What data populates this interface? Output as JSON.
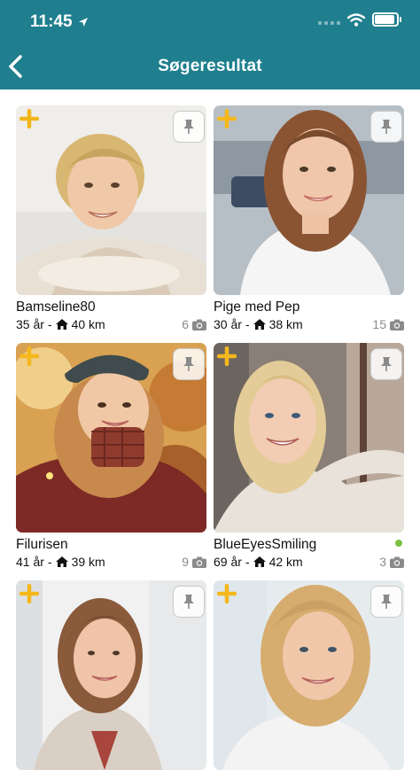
{
  "status": {
    "time": "11:45"
  },
  "header": {
    "title": "Søgeresultat",
    "back_icon": "chevron-left-icon"
  },
  "colors": {
    "header_bg": "#1f7f8e",
    "plus_icon": "#f4b81c",
    "online": "#7cc242"
  },
  "cards": [
    {
      "name": "Bamseline80",
      "age": "35 år",
      "distance": "40 km",
      "photos": "6",
      "online": false,
      "photo_desc": "woman-short-blonde-hair"
    },
    {
      "name": "Pige med Pep",
      "age": "30 år",
      "distance": "38 km",
      "photos": "15",
      "online": false,
      "photo_desc": "woman-long-brown-hair"
    },
    {
      "name": "Filurisen",
      "age": "41 år",
      "distance": "39 km",
      "photos": "9",
      "online": false,
      "photo_desc": "woman-beret-autumn"
    },
    {
      "name": "BlueEyesSmiling",
      "age": "69 år",
      "distance": "42 km",
      "photos": "3",
      "online": true,
      "photo_desc": "woman-blonde-selfie"
    },
    {
      "name": "",
      "age": "",
      "distance": "",
      "photos": "",
      "online": false,
      "photo_desc": "woman-auburn-hair"
    },
    {
      "name": "",
      "age": "",
      "distance": "",
      "photos": "",
      "online": false,
      "photo_desc": "woman-blonde-wavy-hair"
    }
  ],
  "labels": {
    "separator": "-"
  }
}
